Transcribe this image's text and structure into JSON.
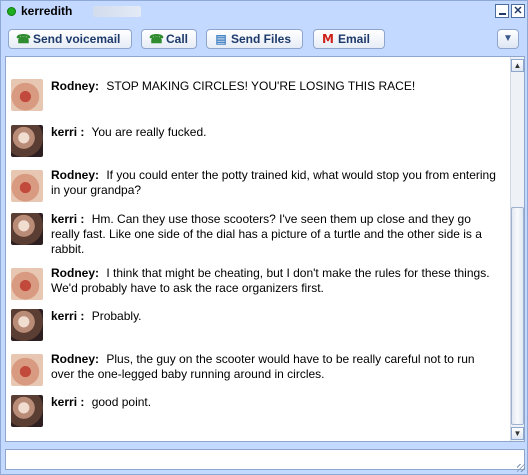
{
  "window": {
    "title": "kerredith",
    "status_color": "#1fae1f",
    "minimize_icon": "minimize-icon",
    "close_label": "✕"
  },
  "toolbar": {
    "send_voicemail": "Send voicemail",
    "call": "Call",
    "send_files": "Send Files",
    "email": "Email",
    "menu_icon": "▼"
  },
  "messages": [
    {
      "sender": "Rodney:",
      "avatar": "rodney",
      "text": "STOP MAKING CIRCLES! YOU'RE LOSING THIS RACE!"
    },
    {
      "sender": "kerri :",
      "avatar": "kerri",
      "text": "You are really fucked."
    },
    {
      "sender": "Rodney:",
      "avatar": "rodney",
      "text": "If you could enter the potty trained kid, what would stop you from entering in your grandpa?"
    },
    {
      "sender": "kerri :",
      "avatar": "kerri",
      "text": "Hm. Can they use those scooters? I've seen them up close and they go really fast. Like one side of the dial has a picture of a turtle and the other side is a rabbit."
    },
    {
      "sender": "Rodney:",
      "avatar": "rodney",
      "text": "I think that might be cheating, but I don't make the rules for these things. We'd probably have to ask the race organizers first."
    },
    {
      "sender": "kerri :",
      "avatar": "kerri",
      "text": "Probably."
    },
    {
      "sender": "Rodney:",
      "avatar": "rodney",
      "text": "Plus, the guy on the scooter would have to be really careful not to run over the one-legged baby running around in circles."
    },
    {
      "sender": "kerri :",
      "avatar": "kerri",
      "text": "good point."
    }
  ],
  "scrollbar": {
    "up": "▲",
    "down": "▼"
  },
  "input": {
    "value": "",
    "placeholder": ""
  }
}
